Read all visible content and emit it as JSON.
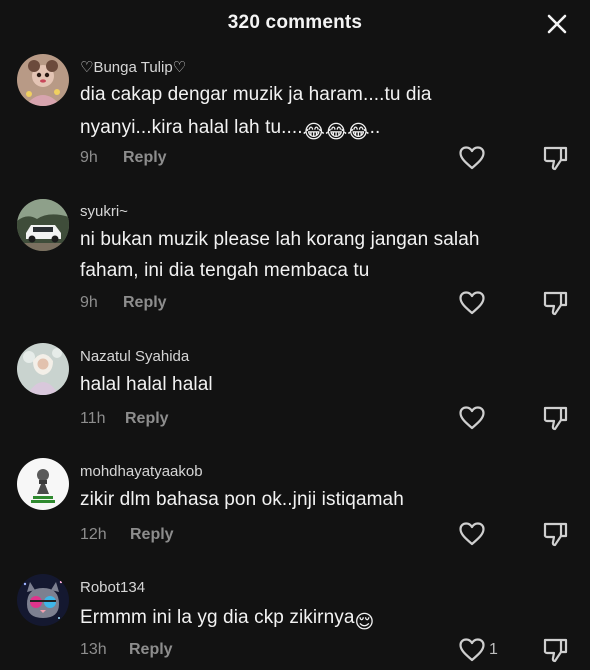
{
  "header": {
    "title": "320 comments"
  },
  "icons": {
    "close": "close-icon",
    "like": "heart-outline-icon",
    "dislike": "thumbs-down-icon"
  },
  "comments": [
    {
      "username": "♡Bunga Tulip♡",
      "lines": [
        "dia cakap dengar muzik ja haram....tu dia",
        "nyanyi...kira halal lah tu...."
      ],
      "line2_suffix": "..",
      "emoji": "😂😂😂",
      "time": "9h",
      "reply": "Reply",
      "likes": ""
    },
    {
      "username": "syukri~",
      "lines": [
        "ni bukan muzik please lah korang jangan salah",
        "faham, ini dia tengah membaca tu"
      ],
      "time": "9h",
      "reply": "Reply",
      "likes": ""
    },
    {
      "username": "Nazatul Syahida",
      "lines": [
        "halal halal halal"
      ],
      "time": "11h",
      "reply": "Reply",
      "likes": ""
    },
    {
      "username": "mohdhayatyaakob",
      "lines": [
        "zikir dlm bahasa pon ok..jnji istiqamah"
      ],
      "time": "12h",
      "reply": "Reply",
      "likes": ""
    },
    {
      "username": "Robot134",
      "lines": [
        "Ermmm ini la yg dia ckp zikirnya"
      ],
      "emoji": "😌",
      "time": "13h",
      "reply": "Reply",
      "likes": "1"
    }
  ]
}
